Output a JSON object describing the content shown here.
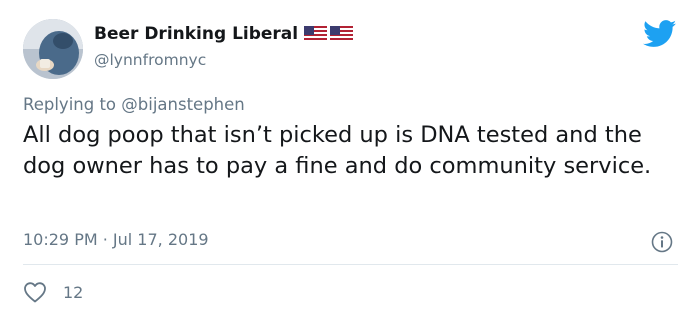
{
  "author": {
    "display_name": "Beer Drinking Liberal",
    "handle": "@lynnfromnyc",
    "flags": [
      "us-flag-icon",
      "us-flag-icon"
    ]
  },
  "reply": {
    "prefix": "Replying to ",
    "mention": "@bijanstephen"
  },
  "tweet": {
    "text": "All dog poop that isn’t picked up is DNA tested and the dog owner has to pay a fine and do community service.",
    "timestamp": "10:29 PM · Jul 17, 2019"
  },
  "actions": {
    "like_count": "12"
  },
  "colors": {
    "twitter_blue": "#1da1f2",
    "secondary_text": "#657786",
    "primary_text": "#14171a",
    "divider": "#e1e8ed"
  },
  "icons": {
    "brand": "twitter-bird-icon",
    "info": "info-icon",
    "like": "heart-icon"
  }
}
